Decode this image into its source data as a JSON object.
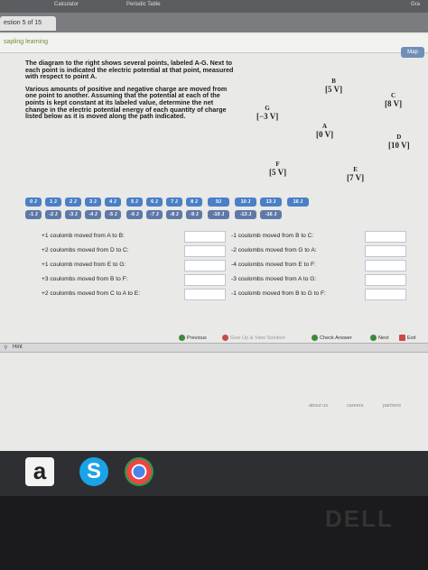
{
  "topbar": {
    "calculator": "Calculator",
    "periodic": "Periodic Table",
    "grade": "Gra"
  },
  "tab": {
    "label": "estion 5 of 15"
  },
  "header": {
    "logo": "sapling learning",
    "map": "Map"
  },
  "problem": {
    "p1": "The diagram to the right shows several points, labeled A-G. Next to each point is indicated the electric potential at that point, measured with respect to point A.",
    "p2": "Various amounts of positive and negative charge are moved from one point to another. Assuming that the potential at each of the points is kept constant at its labeled value, determine the net change in the electric potential energy of each quantity of charge listed below as it is moved along the path indicated."
  },
  "points": [
    {
      "label": "B",
      "value": "[5 V]"
    },
    {
      "label": "C",
      "value": "[8 V]"
    },
    {
      "label": "G",
      "value": "[−3 V]"
    },
    {
      "label": "A",
      "value": "[0 V]"
    },
    {
      "label": "D",
      "value": "[10 V]"
    },
    {
      "label": "F",
      "value": "[5 V]"
    },
    {
      "label": "E",
      "value": "[7 V]"
    }
  ],
  "chips_pos": [
    "0 J",
    "1 J",
    "2 J",
    "3 J",
    "4 J",
    "5 J",
    "6 J",
    "7 J",
    "8 J",
    "9J",
    "10 J",
    "13 J",
    "16 J"
  ],
  "chips_neg": [
    "-1 J",
    "-2 J",
    "-3 J",
    "-4 J",
    "-5 J",
    "-6 J",
    "-7 J",
    "-8 J",
    "-9 J",
    "-10 J",
    "-13 J",
    "-16 J"
  ],
  "left_rows": [
    "+1 coulomb moved from A to B:",
    "+2 coulombs moved from D to C:",
    "+1 coulomb moved from E to G:",
    "+3 coulombs moved from B to F:",
    "+2 coulombs moved from C to A to E:"
  ],
  "right_rows": [
    "-1 coulomb moved from B to C:",
    "-2 coulombs moved from G to A:",
    "-4 coulombs moved from E to F:",
    "-3 coulombs moved from A to G:",
    "-1 coulomb moved from B to G to F:"
  ],
  "nav": {
    "previous": "Previous",
    "giveup": "Give Up & View Solution",
    "check": "Check Answer",
    "next": "Next",
    "exit": "Exit"
  },
  "hint": "Hint",
  "footer": {
    "about": "about us",
    "careers": "careers",
    "partners": "partners"
  },
  "dock": {
    "amazon": "a",
    "skype": "S"
  },
  "brand": "DELL"
}
